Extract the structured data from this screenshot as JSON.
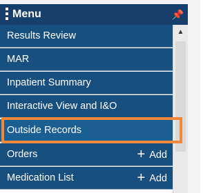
{
  "menu": {
    "title": "Menu",
    "pin_icon": "pin-icon",
    "grip_icon": "grip-icon",
    "items": [
      {
        "label": "Results Review",
        "add": ""
      },
      {
        "label": "MAR",
        "add": ""
      },
      {
        "label": "Inpatient Summary",
        "add": ""
      },
      {
        "label": "Interactive View and I&O",
        "add": ""
      },
      {
        "label": "Outside Records",
        "add": ""
      },
      {
        "label": "Orders",
        "add": "Add"
      },
      {
        "label": "Medication List",
        "add": "Add"
      }
    ]
  },
  "colors": {
    "header_bg": "#163f6b",
    "item_bg": "#17507f",
    "highlight": "#f0883a"
  },
  "highlighted_item": "Outside Records"
}
